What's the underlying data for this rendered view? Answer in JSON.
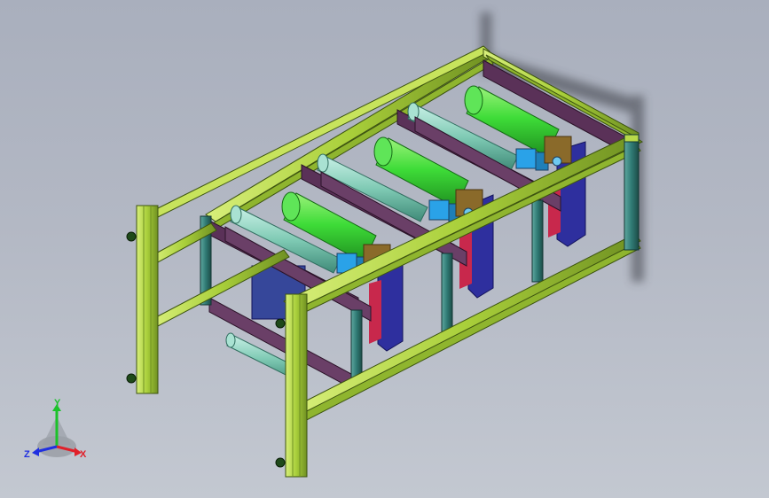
{
  "viewport": {
    "background_top": "#a9afbd",
    "background_bottom": "#c3c8d1"
  },
  "model": {
    "frame_color": "#b8d94a",
    "frame_edge_color": "#3d5410",
    "roller_color": "#4ee04a",
    "idler_roller_color": "#8fd6c2",
    "belt_color": "#6a3f67",
    "side_plate_color": "#2e2f9e",
    "motor_color": "#2aa2e8",
    "red_plate_color": "#c8284c",
    "bracket_color": "#8a6a2a"
  },
  "triad": {
    "x_label": "X",
    "y_label": "Y",
    "z_label": "Z",
    "x_color": "#e0202a",
    "y_color": "#1cc22a",
    "z_color": "#2030e0"
  }
}
